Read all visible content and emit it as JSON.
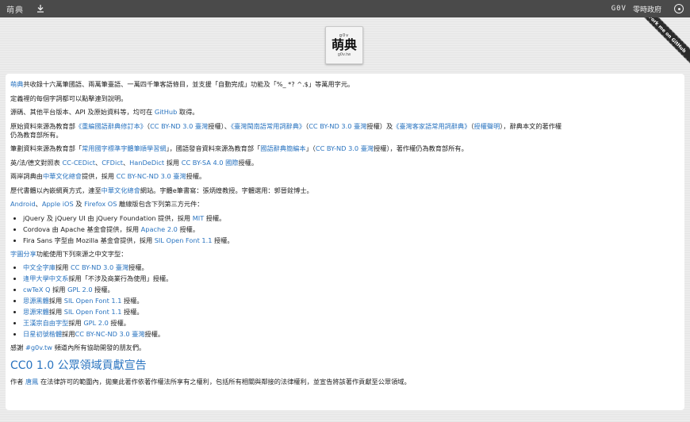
{
  "topbar": {
    "logo_text": "萌典",
    "download_icon": "download-icon",
    "gov_text": "G0V",
    "gov_cn": "零時政府",
    "settings_icon": "settings-icon"
  },
  "ribbon": {
    "label": "Fork me on GitHub"
  },
  "logo": {
    "top": "g0v",
    "main": "萌典",
    "bottom": "g0v.tw"
  },
  "intro": {
    "moedict": "萌典",
    "text": "共收錄十六萬筆國語、兩萬筆臺語、一萬四千筆客語條目，並支援「自動完成」功能及「%_ *? ^.$」等萬用字元。"
  },
  "p_click": {
    "text": "定義裡的每個字詞都可以點擊連到說明。"
  },
  "p_source": {
    "before": "源碼、其他平台版本、API 及原始資料等，均可在 ",
    "link": "GitHub",
    "after": " 取得。"
  },
  "p_data": {
    "t1": "原始資料來源為教育部",
    "l1": "《重編國語辭典修訂本》",
    "t2": "（",
    "l2": "CC BY-ND 3.0 臺灣",
    "t3": "授權）、",
    "l3": "《臺灣閩南語常用詞辭典》",
    "t4": "（",
    "l4": "CC BY-ND 3.0 臺灣",
    "t5": "授權）及",
    "l5": "《臺灣客家語常用詞辭典》",
    "t6": "（",
    "l6": "授權聲明",
    "t7": "），辭典本文的著作權",
    "line2": "仍為教育部所有。"
  },
  "p_stroke": {
    "t1": "筆劃資料來源為教育部「",
    "l1": "常用國字標準字體筆順學習網",
    "t2": "」，國語發音資料來源為教育部「",
    "l2": "國語辭典簡編本",
    "t3": "」（",
    "l3": "CC BY-ND 3.0 臺灣",
    "t4": "授權），著作權仍為教育部所有。"
  },
  "p_foreign": {
    "t1": "英/法/德文對照表 ",
    "l1": "CC-CEDict",
    "t2": "、",
    "l2": "CFDict",
    "t3": "、",
    "l3": "HanDeDict",
    "t4": " 採用 ",
    "l4": "CC BY-SA 4.0 國際",
    "t5": "授權。"
  },
  "p_cross": {
    "t1": "兩岸詞典由",
    "l1": "中華文化總會",
    "t2": "提供，採用 ",
    "l2": "CC BY-NC-ND 3.0 臺灣",
    "t3": "授權。"
  },
  "p_callig": {
    "t1": "歷代書體以內嵌網頁方式，連至",
    "l1": "中華文化總會",
    "t2": "網站。字體e筆書寫：張炳煌教授。字體選用：郭晉銓博士。"
  },
  "p_platforms": {
    "l1": "Android",
    "t1": "、",
    "l2": "Apple iOS",
    "t2": " 及 ",
    "l3": "Firefox OS",
    "t3": " 離線版包含下列第三方元件："
  },
  "components": [
    {
      "t1": "jQuery 及 jQuery UI 由 jQuery Foundation 提供，採用 ",
      "l1": "MIT",
      "t2": " 授權。"
    },
    {
      "t1": "Cordova 由 Apache 基金會提供，採用 ",
      "l1": "Apache 2.0",
      "t2": " 授權。"
    },
    {
      "t1": "Fira Sans 字型由 Mozilla 基金會提供，採用 ",
      "l1": "SIL Open Font 1.1",
      "t2": " 授權。"
    }
  ],
  "p_fonts": {
    "l1": "字圖分享",
    "t1": "功能使用下列來源之中文字型："
  },
  "fonts": [
    {
      "l0": "中文全字庫",
      "t1": "採用 ",
      "l1": "CC BY-ND 3.0 臺灣",
      "t2": "授權。"
    },
    {
      "l0": "逢甲大學中文系",
      "t1": "採用「不涉及商業行為使用」授權。",
      "l1": "",
      "t2": ""
    },
    {
      "l0": "cwTeX Q",
      "t1": " 採用 ",
      "l1": "GPL 2.0",
      "t2": " 授權。"
    },
    {
      "l0": "思源黑體",
      "t1": "採用 ",
      "l1": "SIL Open Font 1.1",
      "t2": " 授權。"
    },
    {
      "l0": "思源宋體",
      "t1": "採用 ",
      "l1": "SIL Open Font 1.1",
      "t2": " 授權。"
    },
    {
      "l0": "王漢宗自由字型",
      "t1": "採用 ",
      "l1": "GPL 2.0",
      "t2": " 授權。"
    },
    {
      "l0": "日星初號楷體",
      "t1": "採用",
      "l1": "CC BY-NC-ND 3.0 臺灣",
      "t2": "授權。"
    }
  ],
  "p_thanks": {
    "t1": "感謝 ",
    "l1": "#g0v.tw",
    "t2": " 頻道內所有協助開發的朋友們。"
  },
  "cc0": {
    "heading": "CC0 1.0 公眾領域貢獻宣告",
    "t1": "作者 ",
    "l1": "唐鳳",
    "t2": " 在法律許可的範圍內，拋棄此著作依著作權法所享有之權利，包括所有相關與鄰接的法律權利，並宣告將該著作貢獻至公眾領域。"
  },
  "colors": {
    "link": "#2a74c0",
    "topbar": "#4a4a4a",
    "background": "#ececec"
  }
}
